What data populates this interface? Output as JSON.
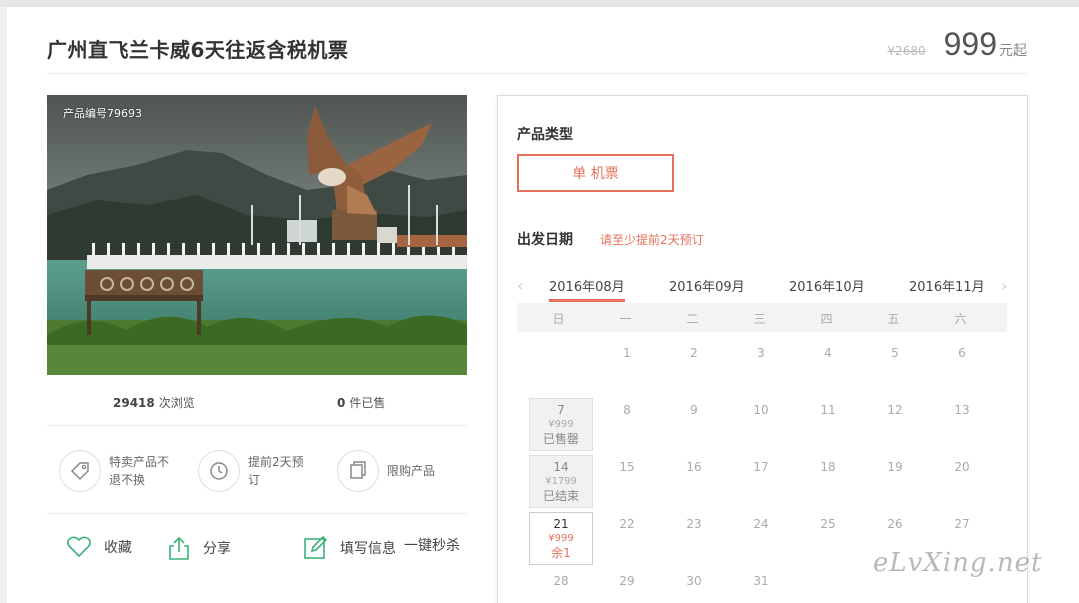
{
  "product": {
    "title": "广州直飞兰卡威6天往返含税机票",
    "old_price": "¥2680",
    "price": "999",
    "price_unit": "元起",
    "code": "产品编号79693"
  },
  "stats": {
    "views_count": "29418",
    "views_label": "次浏览",
    "sold_count": "0",
    "sold_label": "件已售"
  },
  "features": [
    {
      "icon": "tag-icon",
      "text": "特卖产品不退不换"
    },
    {
      "icon": "clock-icon",
      "text": "提前2天预订"
    },
    {
      "icon": "copy-icon",
      "text": "限购产品"
    }
  ],
  "actions": {
    "favorite": "收藏",
    "share": "分享",
    "fill_info": "填写信息",
    "flash_buy": "一键秒杀"
  },
  "booking": {
    "type_label": "产品类型",
    "type_option": "单 机票",
    "date_label": "出发日期",
    "date_hint": "请至少提前2天预订",
    "months": [
      "2016年08月",
      "2016年09月",
      "2016年10月",
      "2016年11月"
    ],
    "selected_month": "2016年08月",
    "weekdays": [
      "日",
      "一",
      "二",
      "三",
      "四",
      "五",
      "六"
    ],
    "days": {
      "row1": [
        "1",
        "2",
        "3",
        "4",
        "5",
        "6"
      ],
      "row2": [
        "8",
        "9",
        "10",
        "11",
        "12",
        "13"
      ],
      "row3": [
        "15",
        "16",
        "17",
        "18",
        "19",
        "20"
      ],
      "row4": [
        "22",
        "23",
        "24",
        "25",
        "26",
        "27"
      ],
      "row5": [
        "28",
        "29",
        "30",
        "31"
      ]
    },
    "special_days": [
      {
        "day": "7",
        "price": "¥999",
        "status": "已售罄"
      },
      {
        "day": "14",
        "price": "¥1799",
        "status": "已结束"
      },
      {
        "day": "21",
        "price": "¥999",
        "status": "余1"
      }
    ]
  },
  "watermark": "eLvXing.net",
  "colors": {
    "accent": "#e7705c",
    "icon_green": "#3cb27a"
  }
}
